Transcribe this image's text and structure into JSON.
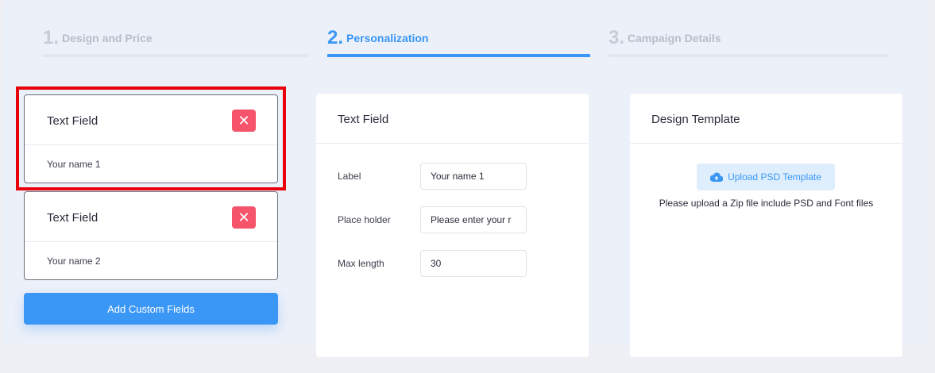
{
  "steps": [
    {
      "num": "1.",
      "title": "Design and Price"
    },
    {
      "num": "2.",
      "title": "Personalization"
    },
    {
      "num": "3.",
      "title": "Campaign Details"
    }
  ],
  "fields": [
    {
      "title": "Text Field",
      "value": "Your name 1",
      "delete": "✕"
    },
    {
      "title": "Text Field",
      "value": "Your name 2",
      "delete": "✕"
    }
  ],
  "add_button": "Add Custom Fields",
  "text_field_card": {
    "title": "Text Field",
    "label_label": "Label",
    "label_value": "Your name 1",
    "placeholder_label": "Place holder",
    "placeholder_value": "Please enter your r",
    "maxlength_label": "Max length",
    "maxlength_value": "30"
  },
  "design_card": {
    "title": "Design Template",
    "upload_label": "Upload PSD Template",
    "note": "Please upload a Zip file include PSD and Font files"
  },
  "colors": {
    "accent": "#3a97f5",
    "danger": "#f5546b",
    "highlight": "#e8000b"
  }
}
